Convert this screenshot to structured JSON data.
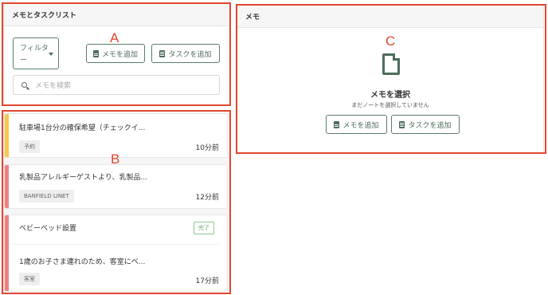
{
  "left_panel": {
    "title": "メモとタスクリスト",
    "filter_label": "フィルター",
    "add_memo": "メモを追加",
    "add_task": "タスクを追加",
    "search_placeholder": "メモを検索"
  },
  "list": [
    {
      "title": "駐車場1台分の確保希望（チェックイ...",
      "tag": "予約",
      "time": "10分前",
      "color": "#f5c84c"
    },
    {
      "title": "乳製品アレルギーゲストより、乳製品...",
      "tag": "BANFIELD LINET",
      "time": "12分前",
      "color": "#f08080"
    },
    {
      "title": "ベビーベッド設置",
      "badge": "完了",
      "subtitle": "1歳のお子さま連れのため、客室にベ...",
      "tag": "客室",
      "time": "17分前",
      "color": "#f08080"
    }
  ],
  "right_panel": {
    "title": "メモ",
    "empty_title": "メモを選択",
    "empty_sub": "まだノートを選択していません",
    "add_memo": "メモを追加",
    "add_task": "タスクを追加"
  },
  "annotations": {
    "a": "A",
    "b": "B",
    "c": "C"
  }
}
